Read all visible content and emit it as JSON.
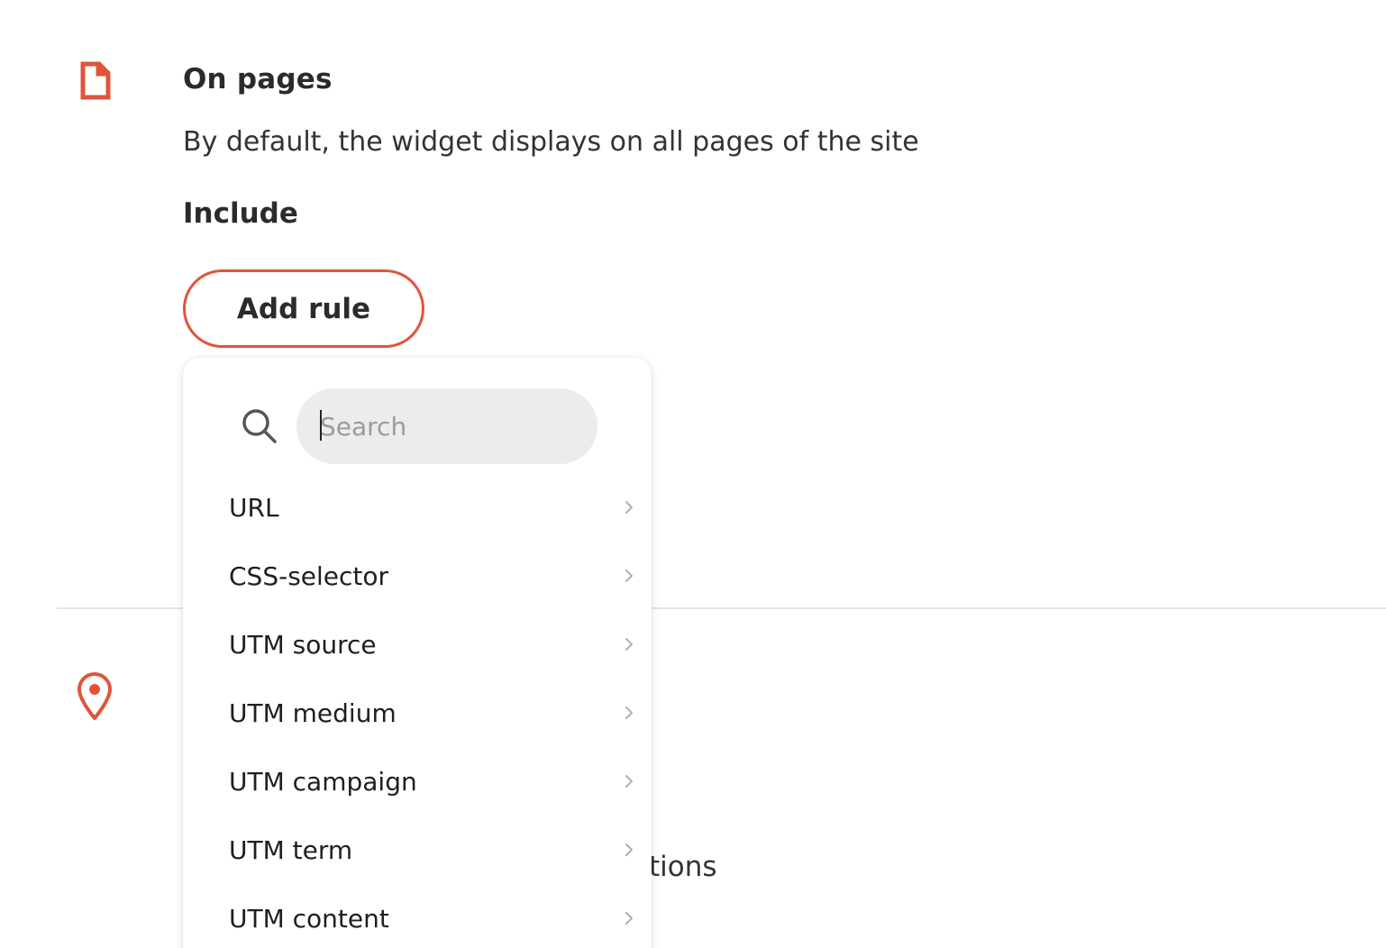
{
  "section": {
    "title": "On pages",
    "description": "By default, the widget displays on all pages of the site",
    "include_label": "Include",
    "add_rule_label": "Add rule"
  },
  "background": {
    "partial_text": "tions"
  },
  "dropdown": {
    "search_placeholder": "Search",
    "items": [
      {
        "label": "URL"
      },
      {
        "label": "CSS-selector"
      },
      {
        "label": "UTM source"
      },
      {
        "label": "UTM medium"
      },
      {
        "label": "UTM campaign"
      },
      {
        "label": "UTM term"
      },
      {
        "label": "UTM content"
      }
    ]
  },
  "colors": {
    "accent": "#e0553a",
    "search_bg": "#ececec",
    "divider": "#e4e4e4"
  },
  "icons": {
    "page": "page-icon",
    "location": "location-pin-icon",
    "search": "search-icon",
    "chevron": "chevron-right-icon"
  }
}
